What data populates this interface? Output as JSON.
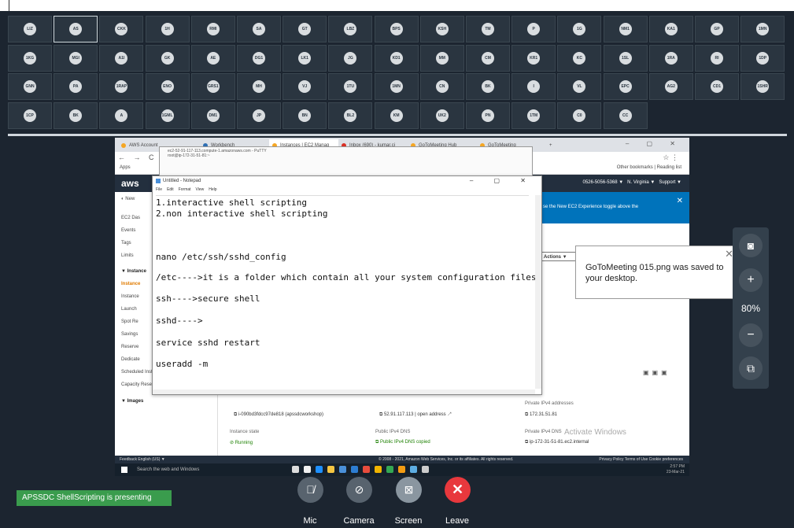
{
  "gallery": {
    "rows": [
      [
        "LIZ",
        "AS",
        "CKK",
        "1H",
        "RMI",
        "SA",
        "GT",
        "LBZ",
        "BPS",
        "KSH",
        "TM",
        "P",
        "1G",
        "NM1",
        "KA1",
        "GP",
        "1MN"
      ],
      [
        "1KG",
        "MGI",
        "A1I",
        "GK",
        "AE",
        "DG1",
        "LK1",
        "JG",
        "KD1",
        "MM",
        "CM",
        "KR1",
        "KC",
        "1SL",
        "1RA",
        "RI",
        "1DP"
      ],
      [
        "GNN",
        "PA",
        "1RAP",
        "ENO",
        "GRS1",
        "MH",
        "VJ",
        "1TU",
        "1MN",
        "CN",
        "BK",
        "I",
        "VL",
        "EPC",
        "AG2",
        "CD1",
        "1SHR"
      ],
      [
        "1CP",
        "BK",
        "A",
        "1GML",
        "DM1",
        "JP",
        "BN",
        "BL2",
        "KM",
        "UK2",
        "PN",
        "1TM",
        "C0",
        "CC"
      ]
    ]
  },
  "browser": {
    "tabs": [
      "AWS Account",
      "Workbench",
      "Instances | EC2 Manag",
      "Inbox (690) - kumar.ci",
      "GoToMeeting Hub",
      "GoToMeeting"
    ],
    "new_tab": "+",
    "apps_label": "Apps",
    "other_bookmarks": "Other bookmarks",
    "reading_list": "Reading list"
  },
  "ssh": {
    "title": "ec2-52-91-117-113.compute-1.amazonaws.com - PuTTY",
    "subtitle": "root@ip-172-31-51-81:~"
  },
  "aws": {
    "logo": "aws",
    "account": "0526-5056-5368 ▼",
    "region": "N. Virginia ▼",
    "support": "Support ▼",
    "banner_text": "se the New EC2 Experience toggle above the",
    "new_toggle": "New",
    "sidebar": [
      "EC2 Das",
      "Events",
      "Tags",
      "Limits",
      "▼ Instance",
      "Instance",
      "Instance",
      "Launch",
      "Spot Re",
      "Savings",
      "Reserve",
      "Dedicate",
      "Scheduled Instances",
      "Capacity Reservations",
      "▼ Images"
    ],
    "actions": "Actions ▼",
    "instance_id": "i-090bd3fdcc97de818 (apssdcworkshop)",
    "public_ip": "52.91.117.113 | open address",
    "private_ip_label": "Private IPv4 addresses",
    "private_ip": "172.31.51.81",
    "state_label": "Instance state",
    "state": "Running",
    "dns_label": "Public IPv4 DNS",
    "dns_copied": "Public IPv4 DNS copied",
    "private_dns_label": "Private IPv4 DNS",
    "private_dns": "ip-172-31-51-81.ec2.internal",
    "activate": "Activate Windows",
    "footer_left": "Feedback   English (US) ▼",
    "footer_mid": "© 2008 - 2021, Amazon Web Services, Inc. or its affiliates. All rights reserved.",
    "footer_right": "Privacy Policy    Terms of Use    Cookie preferences"
  },
  "taskbar": {
    "search": "Search the web and Windows",
    "time": "2:57 PM",
    "date": "23-Mar-21"
  },
  "notepad": {
    "title": "Untitled - Notepad",
    "menu": [
      "File",
      "Edit",
      "Format",
      "View",
      "Help"
    ],
    "lines": [
      "1.interactive shell scripting",
      "2.non interactive shell scripting",
      "nano /etc/ssh/sshd_config",
      "/etc---->it is a folder which contain all your system configuration files",
      "ssh---->secure shell",
      "sshd---->",
      "service sshd restart",
      "useradd -m"
    ]
  },
  "toast": {
    "message": "GoToMeeting 015.png was saved to your desktop."
  },
  "zoom": {
    "level": "80%"
  },
  "presenting": "APSSDC ShellScripting is presenting",
  "controls": {
    "mic": "Mic",
    "camera": "Camera",
    "screen": "Screen",
    "leave": "Leave"
  }
}
